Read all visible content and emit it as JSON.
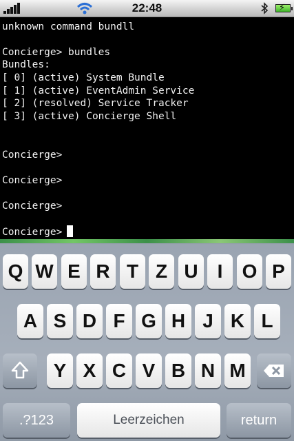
{
  "status_bar": {
    "time": "22:48",
    "icons": [
      "signal-bars-icon",
      "wifi-icon",
      "bluetooth-icon",
      "battery-charging-icon"
    ]
  },
  "terminal": {
    "lines": [
      "unknown command bundll",
      "",
      "Concierge> bundles",
      "Bundles:",
      "[ 0] (active) System Bundle",
      "[ 1] (active) EventAdmin Service",
      "[ 2] (resolved) Service Tracker",
      "[ 3] (active) Concierge Shell",
      "",
      "",
      "Concierge>",
      "",
      "Concierge>",
      "",
      "Concierge>",
      ""
    ],
    "prompt": "Concierge>"
  },
  "keyboard": {
    "row1": [
      "Q",
      "W",
      "E",
      "R",
      "T",
      "Z",
      "U",
      "I",
      "O",
      "P"
    ],
    "row2": [
      "A",
      "S",
      "D",
      "F",
      "G",
      "H",
      "J",
      "K",
      "L"
    ],
    "row3": [
      "Y",
      "X",
      "C",
      "V",
      "B",
      "N",
      "M"
    ],
    "shift_icon": "shift-arrow-icon",
    "backspace_icon": "backspace-icon",
    "numbers_label": ".?123",
    "space_label": "Leerzeichen",
    "return_label": "return"
  }
}
